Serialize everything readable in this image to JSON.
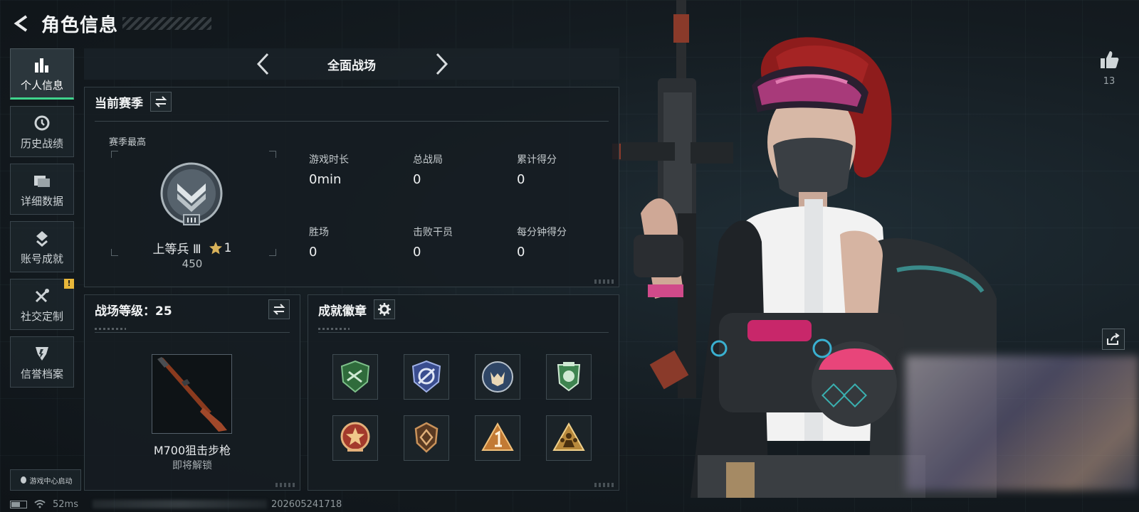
{
  "header": {
    "title": "角色信息"
  },
  "sidebar": {
    "items": [
      {
        "label": "个人信息",
        "icon": "bar-chart-icon",
        "active": true
      },
      {
        "label": "历史战绩",
        "icon": "history-clock-icon"
      },
      {
        "label": "详细数据",
        "icon": "folder-icon"
      },
      {
        "label": "账号成就",
        "icon": "achievement-icon"
      },
      {
        "label": "社交定制",
        "icon": "tools-icon",
        "badge": "!"
      },
      {
        "label": "信誉档案",
        "icon": "reputation-icon"
      }
    ],
    "launch_label": "游戏中心启动"
  },
  "mode": {
    "title": "全面战场"
  },
  "season": {
    "title": "当前赛季",
    "best_label": "赛季最高",
    "rank_name": "上等兵 Ⅲ",
    "rank_stars": "1",
    "rank_score": "450",
    "stats": [
      {
        "label": "游戏时长",
        "value": "0min"
      },
      {
        "label": "总战局",
        "value": "0"
      },
      {
        "label": "累计得分",
        "value": "0"
      },
      {
        "label": "胜场",
        "value": "0"
      },
      {
        "label": "击败干员",
        "value": "0"
      },
      {
        "label": "每分钟得分",
        "value": "0"
      }
    ]
  },
  "battlefield": {
    "title": "战场等级：25",
    "weapon_name": "M700狙击步枪",
    "weapon_status": "即将解锁"
  },
  "achievements": {
    "title": "成就徽章",
    "badges": [
      {
        "icon": "green-shield-badge-icon",
        "color": "#3f8f4e"
      },
      {
        "icon": "blue-shield-badge-icon",
        "color": "#4a5da8"
      },
      {
        "icon": "wolf-badge-icon",
        "color": "#3b5a8a"
      },
      {
        "icon": "green-emblem-badge-icon",
        "color": "#4a9a5c"
      },
      {
        "icon": "star-circle-badge-icon",
        "color": "#c0503c"
      },
      {
        "icon": "bronze-shield-badge-icon",
        "color": "#9a6a3c"
      },
      {
        "icon": "number-one-badge-icon",
        "color": "#c8823a"
      },
      {
        "icon": "squad-triangle-badge-icon",
        "color": "#c09040"
      }
    ]
  },
  "profile": {
    "like_count": "13"
  },
  "status_bar": {
    "ping": "52ms",
    "id": "202605241718"
  },
  "colors": {
    "accent": "#3fd48c",
    "panel_bg": "#161d22",
    "notice": "#e8b73a"
  }
}
